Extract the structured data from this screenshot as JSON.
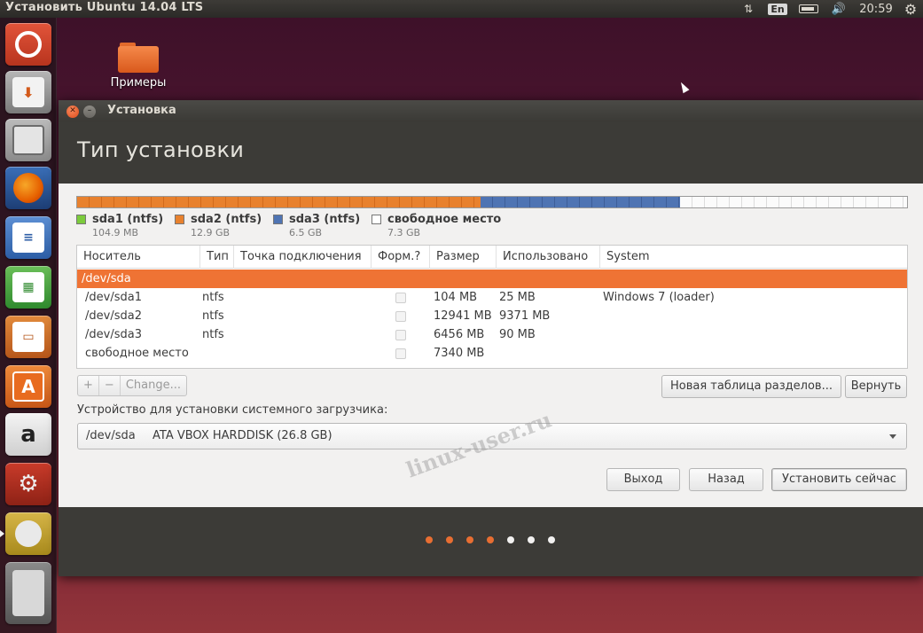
{
  "top_panel": {
    "title": "Установить Ubuntu 14.04 LTS",
    "lang": "En",
    "clock": "20:59",
    "network_icon": "network-arrows-icon",
    "battery_icon": "battery-icon",
    "volume_icon": "volume-icon",
    "settings_icon": "gear-icon"
  },
  "launcher": {
    "items": [
      {
        "name": "ubuntu-dash-icon"
      },
      {
        "name": "ubuntu-installer-icon"
      },
      {
        "name": "files-icon"
      },
      {
        "name": "firefox-icon"
      },
      {
        "name": "libreoffice-writer-icon"
      },
      {
        "name": "libreoffice-calc-icon"
      },
      {
        "name": "libreoffice-impress-icon"
      },
      {
        "name": "software-center-icon"
      },
      {
        "name": "amazon-icon"
      },
      {
        "name": "system-settings-icon"
      },
      {
        "name": "installer-drive-icon"
      },
      {
        "name": "trash-icon"
      }
    ],
    "amazon_glyph": "a",
    "software_glyph": "A"
  },
  "desktop": {
    "folder_label": "Примеры"
  },
  "window": {
    "title": "Установка",
    "heading": "Тип установки",
    "partitions": [
      {
        "name": "sda1 (ntfs)",
        "size": "104.9 MB",
        "color": "#7ccb3c"
      },
      {
        "name": "sda2 (ntfs)",
        "size": "12.9 GB",
        "color": "#e8812e"
      },
      {
        "name": "sda3 (ntfs)",
        "size": "6.5 GB",
        "color": "#4f74b3"
      },
      {
        "name": "свободное место",
        "size": "7.3 GB",
        "color": "#ffffff"
      }
    ],
    "table": {
      "headers": [
        "Носитель",
        "Тип",
        "Точка подключения",
        "Форм.?",
        "Размер",
        "Использовано",
        "System"
      ],
      "rows": [
        {
          "device": "/dev/sda",
          "type": "",
          "size": "",
          "used": "",
          "system": "",
          "selected": true
        },
        {
          "device": "/dev/sda1",
          "type": "ntfs",
          "size": "104 MB",
          "used": "25 MB",
          "system": "Windows 7 (loader)"
        },
        {
          "device": "/dev/sda2",
          "type": "ntfs",
          "size": "12941 MB",
          "used": "9371 MB",
          "system": ""
        },
        {
          "device": "/dev/sda3",
          "type": "ntfs",
          "size": "6456 MB",
          "used": "90 MB",
          "system": ""
        },
        {
          "device": "свободное место",
          "type": "",
          "size": "7340 MB",
          "used": "",
          "system": ""
        }
      ]
    },
    "toolbar": {
      "add": "+",
      "remove": "−",
      "change": "Change...",
      "new_table": "Новая таблица разделов...",
      "revert": "Вернуть"
    },
    "bootloader": {
      "label": "Устройство для установки системного загрузчика:",
      "device": "/dev/sda",
      "description": "ATA VBOX HARDDISK (26.8 GB)"
    },
    "watermark": "linux-user.ru",
    "buttons": {
      "quit": "Выход",
      "back": "Назад",
      "install": "Установить сейчас"
    },
    "progress": {
      "total": 7,
      "completed": 4
    }
  },
  "colors": {
    "accent": "#ef7334",
    "header_bg": "#3c3b37",
    "free_space": "#ffffff"
  }
}
